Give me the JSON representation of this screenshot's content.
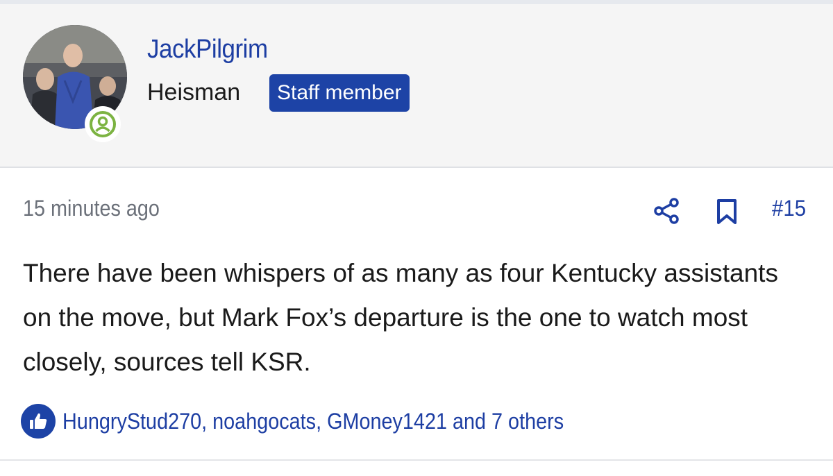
{
  "colors": {
    "link_blue": "#1d3ea3",
    "badge_blue": "#1d43a6",
    "online_green": "#7cb342",
    "muted_text": "#6b7079",
    "header_bg": "#f5f5f5"
  },
  "user": {
    "avatar_icon": "user-photo",
    "online_icon": "user-online-icon",
    "username": "JackPilgrim",
    "title": "Heisman",
    "badge": "Staff member"
  },
  "post": {
    "timestamp": "15 minutes ago",
    "share_icon": "share-icon",
    "bookmark_icon": "bookmark-icon",
    "number": "#15",
    "message": "There have been whispers of as many as four Kentucky assistants on the move, but Mark Fox’s departure is the one to watch most closely, sources tell KSR.",
    "reactions": {
      "icon": "thumbs-up-icon",
      "text": "HungryStud270, noahgocats, GMoney1421 and 7 others"
    }
  }
}
